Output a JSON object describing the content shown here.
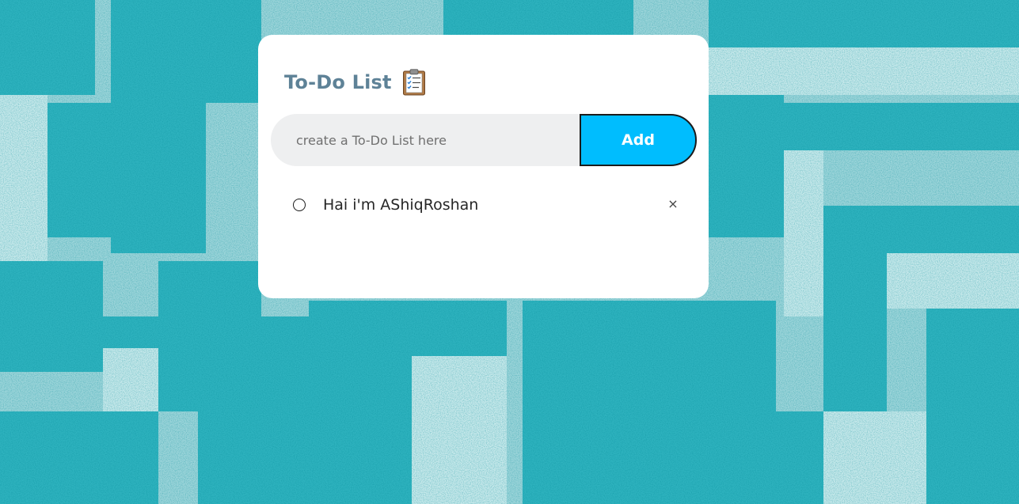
{
  "app": {
    "title": "To-Do List",
    "title_icon": "clipboard-icon"
  },
  "input": {
    "placeholder": "create a To-Do List here",
    "value": ""
  },
  "add_button": {
    "label": "Add",
    "color": "#00bdfe"
  },
  "todos": [
    {
      "text": "Hai i'm AShiqRoshan",
      "completed": false,
      "check_icon": "circle-unchecked-icon",
      "remove_label": "×",
      "remove_icon": "close-icon"
    }
  ],
  "colors": {
    "title": "#5e8297",
    "card": "#ffffff",
    "input_bg": "#eeeff0",
    "background": "#8fd0d6"
  }
}
